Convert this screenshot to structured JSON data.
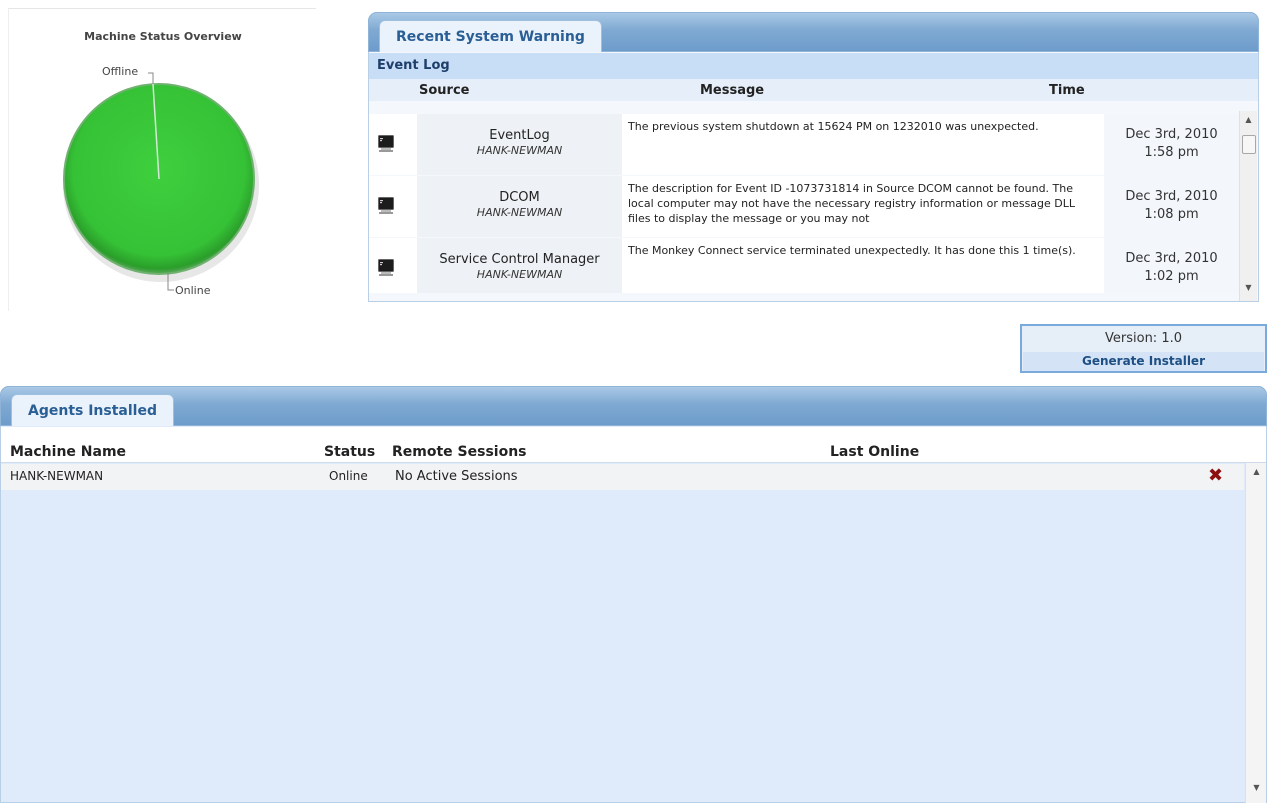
{
  "machine_status": {
    "title": "Machine Status Overview",
    "labels": {
      "offline": "Offline",
      "online": "Online"
    },
    "colors": {
      "online": "#3cbf3c",
      "offline": "#cccccc"
    },
    "chart_data": {
      "type": "pie",
      "title": "Machine Status Overview",
      "categories": [
        "Offline",
        "Online"
      ],
      "values": [
        0,
        1
      ]
    }
  },
  "recent_warning": {
    "tab_label": "Recent System Warning",
    "section_title": "Event Log",
    "columns": {
      "source": "Source",
      "message": "Message",
      "time": "Time"
    },
    "rows": [
      {
        "icon": "terminal-icon",
        "source": "EventLog",
        "machine": "HANK-NEWMAN",
        "message": "The previous system shutdown at 15624 PM on 1232010 was unexpected.",
        "date": "Dec 3rd, 2010",
        "time": "1:58 pm"
      },
      {
        "icon": "terminal-icon",
        "source": "DCOM",
        "machine": "HANK-NEWMAN",
        "message": "The description for Event ID -1073731814 in Source DCOM cannot be found. The local computer may not have the necessary registry information or message DLL files to display the message or you may not",
        "date": "Dec 3rd, 2010",
        "time": "1:08 pm"
      },
      {
        "icon": "terminal-icon",
        "source": "Service Control Manager",
        "machine": "HANK-NEWMAN",
        "message": "The Monkey Connect service terminated unexpectedly. It has done this 1 time(s).",
        "date": "Dec 3rd, 2010",
        "time": "1:02 pm"
      }
    ]
  },
  "version_box": {
    "version": "Version: 1.0",
    "generate_label": "Generate Installer"
  },
  "agents": {
    "tab_label": "Agents Installed",
    "columns": {
      "machine_name": "Machine Name",
      "status": "Status",
      "remote_sessions": "Remote Sessions",
      "last_online": "Last Online"
    },
    "rows": [
      {
        "machine_name": "HANK-NEWMAN",
        "status": "Online",
        "remote_sessions": "No Active Sessions",
        "last_online": "",
        "delete_icon": "delete-x-icon"
      }
    ]
  },
  "icons": {
    "scroll_up": "▲",
    "scroll_down": "▼",
    "delete": "✖"
  }
}
